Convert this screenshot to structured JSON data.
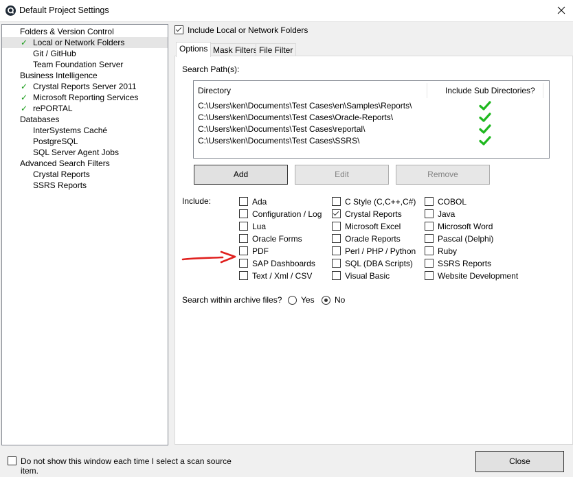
{
  "window": {
    "title": "Default Project Settings"
  },
  "tree": {
    "items": [
      {
        "label": "Folders & Version Control",
        "indent": 0,
        "checked": false,
        "selected": false
      },
      {
        "label": "Local or Network Folders",
        "indent": 1,
        "checked": true,
        "selected": true
      },
      {
        "label": "Git / GitHub",
        "indent": 1,
        "checked": false,
        "selected": false
      },
      {
        "label": "Team Foundation Server",
        "indent": 1,
        "checked": false,
        "selected": false
      },
      {
        "label": "Business Intelligence",
        "indent": 0,
        "checked": false,
        "selected": false
      },
      {
        "label": "Crystal Reports Server 2011",
        "indent": 1,
        "checked": true,
        "selected": false
      },
      {
        "label": "Microsoft Reporting Services",
        "indent": 1,
        "checked": true,
        "selected": false
      },
      {
        "label": "rePORTAL",
        "indent": 1,
        "checked": true,
        "selected": false
      },
      {
        "label": "Databases",
        "indent": 0,
        "checked": false,
        "selected": false
      },
      {
        "label": "InterSystems Caché",
        "indent": 1,
        "checked": false,
        "selected": false
      },
      {
        "label": "PostgreSQL",
        "indent": 1,
        "checked": false,
        "selected": false
      },
      {
        "label": "SQL Server Agent Jobs",
        "indent": 1,
        "checked": false,
        "selected": false
      },
      {
        "label": "Advanced Search Filters",
        "indent": 0,
        "checked": false,
        "selected": false
      },
      {
        "label": "Crystal Reports",
        "indent": 1,
        "checked": false,
        "selected": false
      },
      {
        "label": "SSRS Reports",
        "indent": 1,
        "checked": false,
        "selected": false
      }
    ]
  },
  "include_network": {
    "label": "Include Local or Network Folders",
    "checked": true
  },
  "tabs": [
    {
      "label": "Options",
      "active": true
    },
    {
      "label": "Mask Filters",
      "active": false
    },
    {
      "label": "File Filter",
      "active": false
    }
  ],
  "search_paths": {
    "label": "Search Path(s):",
    "columns": [
      "Directory",
      "Include Sub Directories?"
    ],
    "rows": [
      {
        "directory": "C:\\Users\\ken\\Documents\\Test Cases\\en\\Samples\\Reports\\",
        "sub": true
      },
      {
        "directory": "C:\\Users\\ken\\Documents\\Test Cases\\Oracle-Reports\\",
        "sub": true
      },
      {
        "directory": "C:\\Users\\ken\\Documents\\Test Cases\\reportal\\",
        "sub": true
      },
      {
        "directory": "C:\\Users\\ken\\Documents\\Test Cases\\SSRS\\",
        "sub": true
      }
    ]
  },
  "buttons": {
    "add": "Add",
    "edit": "Edit",
    "remove": "Remove",
    "close": "Close"
  },
  "include": {
    "label": "Include:",
    "columns": [
      [
        {
          "label": "Ada",
          "checked": false
        },
        {
          "label": "Configuration / Log",
          "checked": false
        },
        {
          "label": "Lua",
          "checked": false
        },
        {
          "label": "Oracle Forms",
          "checked": false
        },
        {
          "label": "PDF",
          "checked": false
        },
        {
          "label": "SAP Dashboards",
          "checked": false
        },
        {
          "label": "Text / Xml / CSV",
          "checked": false
        }
      ],
      [
        {
          "label": "C Style (C,C++,C#)",
          "checked": false
        },
        {
          "label": "Crystal Reports",
          "checked": true
        },
        {
          "label": "Microsoft Excel",
          "checked": false
        },
        {
          "label": "Oracle Reports",
          "checked": false
        },
        {
          "label": "Perl / PHP / Python",
          "checked": false
        },
        {
          "label": "SQL (DBA Scripts)",
          "checked": false
        },
        {
          "label": "Visual Basic",
          "checked": false
        }
      ],
      [
        {
          "label": "COBOL",
          "checked": false
        },
        {
          "label": "Java",
          "checked": false
        },
        {
          "label": "Microsoft Word",
          "checked": false
        },
        {
          "label": "Pascal (Delphi)",
          "checked": false
        },
        {
          "label": "Ruby",
          "checked": false
        },
        {
          "label": "SSRS Reports",
          "checked": false
        },
        {
          "label": "Website Development",
          "checked": false
        }
      ]
    ]
  },
  "archive": {
    "label": "Search within archive files?",
    "yes": "Yes",
    "no": "No",
    "selected": "No"
  },
  "footer": {
    "dont_show_label": "Do not show this window each time I select a scan source item.",
    "dont_show_checked": false
  },
  "colors": {
    "check_green": "#1a9d1a",
    "arrow_red": "#e0201e"
  }
}
